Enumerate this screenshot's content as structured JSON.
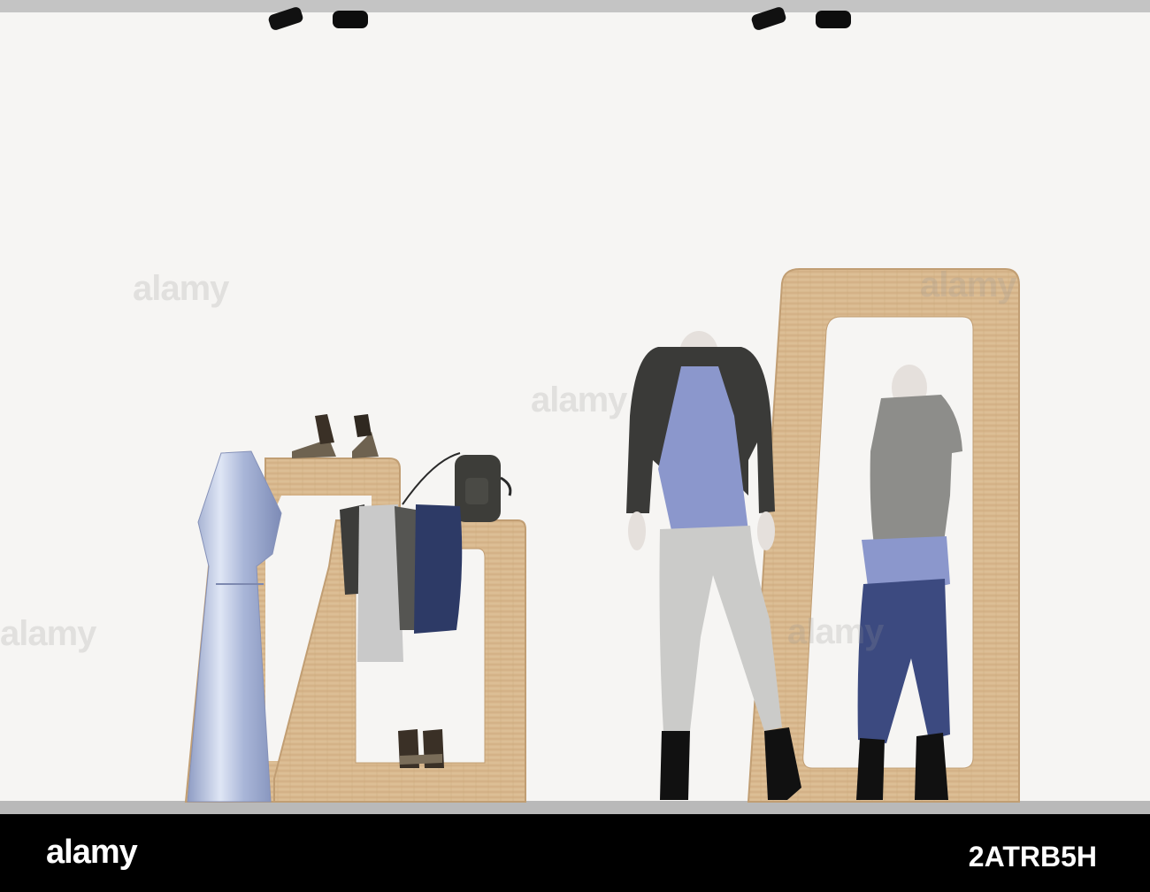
{
  "watermark": {
    "logo": "alamy",
    "image_id": "2ATRB5H",
    "overlay_text": "alamy"
  },
  "colors": {
    "wall": "#f6f5f3",
    "floor": "#b9b9b9",
    "wood": "#d8b88e",
    "wood_edge": "#c19e73",
    "footer": "#000000",
    "satin": "#b6c2de",
    "periwinkle": "#8b97cc",
    "denim": "#2d3a66",
    "grey_cloth": "#c9c9c9",
    "leather": "#353535"
  },
  "scene": {
    "objects": [
      "spotlight-icon",
      "spotlight-icon",
      "spotlight-icon",
      "spotlight-icon",
      "wooden-display-stand",
      "wooden-mirror-frame",
      "satin-dress",
      "wedge-sandals",
      "leather-backpack",
      "hanging-garments",
      "sandals",
      "mannequin-left",
      "mannequin-right"
    ]
  }
}
